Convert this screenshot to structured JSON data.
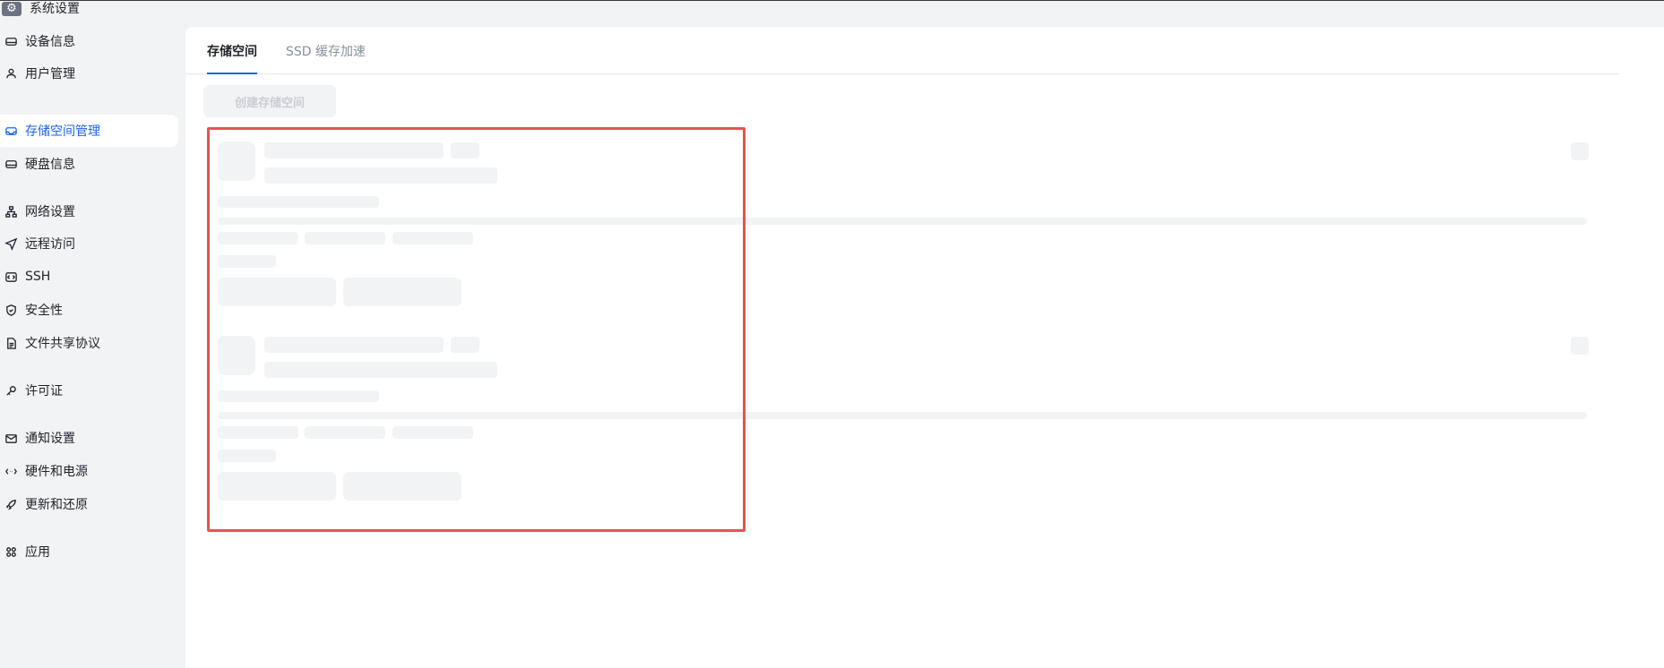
{
  "app": {
    "title": "系统设置",
    "icon": "gear-icon"
  },
  "sidebar": {
    "items": [
      {
        "label": "设备信息",
        "icon": "hard-drive-icon",
        "active": false
      },
      {
        "label": "用户管理",
        "icon": "user-group-icon",
        "active": false
      },
      {
        "label": "存储空间管理",
        "icon": "storage-icon",
        "active": true
      },
      {
        "label": "硬盘信息",
        "icon": "disk-icon",
        "active": false
      },
      {
        "label": "网络设置",
        "icon": "network-icon",
        "active": false
      },
      {
        "label": "远程访问",
        "icon": "send-icon",
        "active": false
      },
      {
        "label": "SSH",
        "icon": "terminal-icon",
        "active": false
      },
      {
        "label": "安全性",
        "icon": "shield-icon",
        "active": false
      },
      {
        "label": "文件共享协议",
        "icon": "document-icon",
        "active": false
      },
      {
        "label": "许可证",
        "icon": "key-icon",
        "active": false
      },
      {
        "label": "通知设置",
        "icon": "mail-icon",
        "active": false
      },
      {
        "label": "硬件和电源",
        "icon": "plug-icon",
        "active": false
      },
      {
        "label": "更新和还原",
        "icon": "rocket-icon",
        "active": false
      },
      {
        "label": "应用",
        "icon": "apps-icon",
        "active": false
      }
    ]
  },
  "main": {
    "tabs": [
      {
        "label": "存储空间",
        "active": true
      },
      {
        "label": "SSD 缓存加速",
        "active": false
      }
    ],
    "create_button": "创建存储空间"
  },
  "colors": {
    "accent": "#1d63ea",
    "highlight": "#e55353",
    "skeleton": "#f2f3f5"
  }
}
